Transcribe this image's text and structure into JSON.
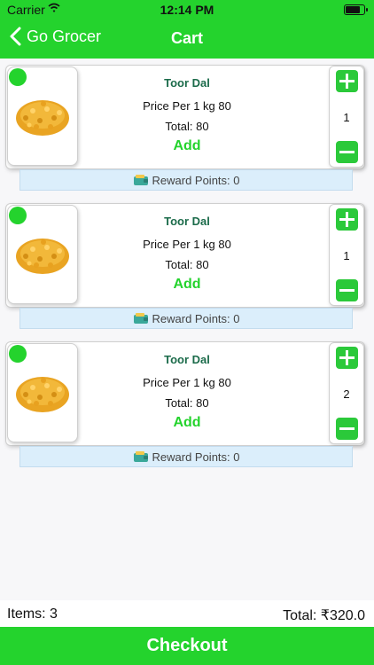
{
  "status": {
    "carrier": "Carrier",
    "time": "12:14 PM",
    "battery_level": 0.85
  },
  "nav": {
    "back_label": "Go Grocer",
    "title": "Cart"
  },
  "colors": {
    "accent": "#24d32d",
    "reward_bg": "#dbeefb",
    "product_name": "#1b6b4a"
  },
  "cart": {
    "items": [
      {
        "name": "Toor Dal",
        "price_text": "Price Per 1 kg 80",
        "total_text": "Total: 80",
        "add_label": "Add",
        "quantity": "1",
        "reward_text": "Reward Points: 0"
      },
      {
        "name": "Toor Dal",
        "price_text": "Price Per 1 kg 80",
        "total_text": "Total: 80",
        "add_label": "Add",
        "quantity": "1",
        "reward_text": "Reward Points: 0"
      },
      {
        "name": "Toor Dal",
        "price_text": "Price Per 1 kg 80",
        "total_text": "Total: 80",
        "add_label": "Add",
        "quantity": "2",
        "reward_text": "Reward Points: 0"
      }
    ]
  },
  "footer": {
    "items_label": "Items: 3",
    "total_label": "Total: ₹320.0",
    "checkout_label": "Checkout"
  }
}
